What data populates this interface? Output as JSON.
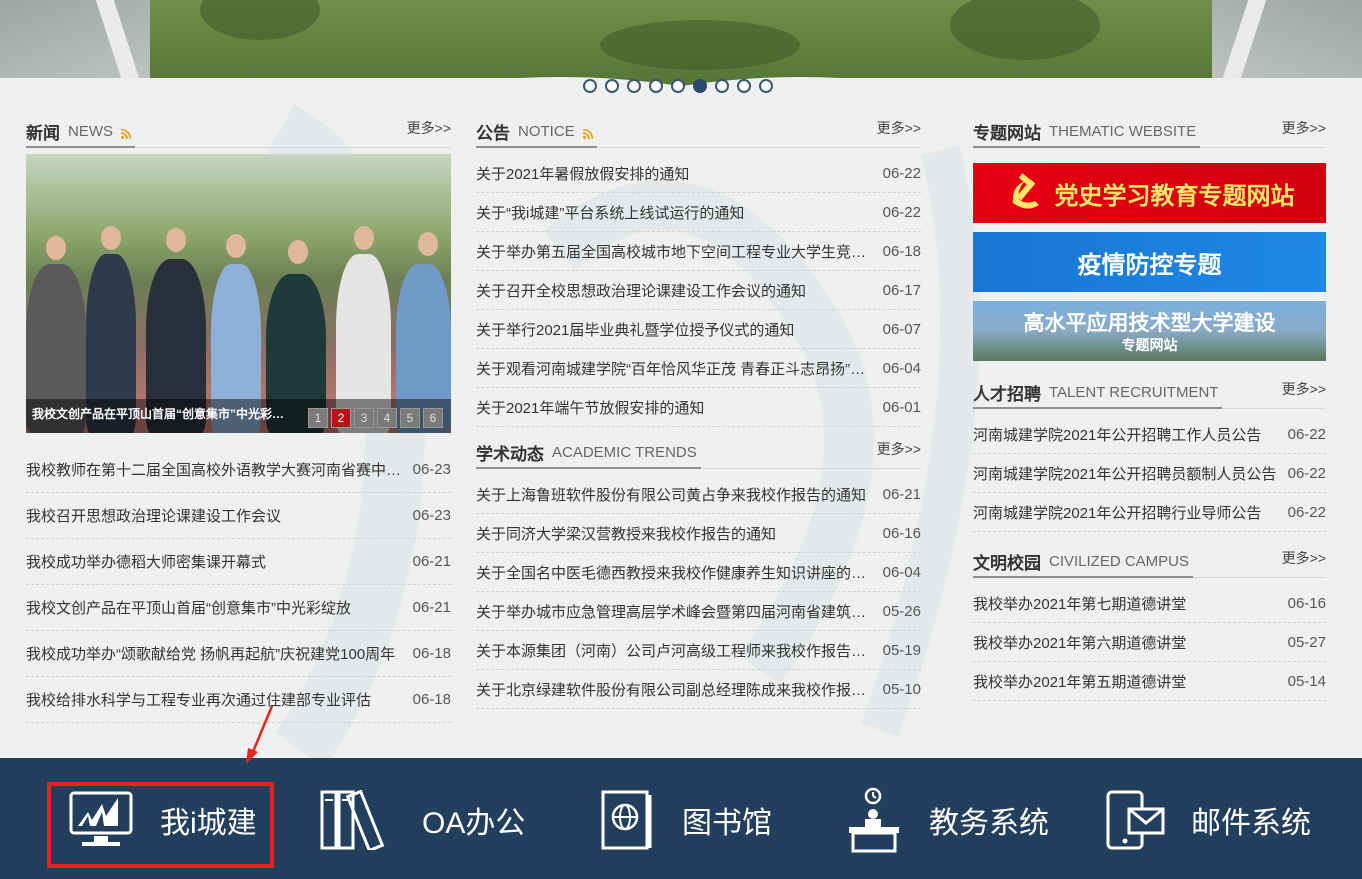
{
  "carousel": {
    "dots": 9,
    "active_index": 5
  },
  "news": {
    "title_cn": "新闻",
    "title_en": "NEWS",
    "more": "更多>>",
    "photo_caption": "我校文创产品在平顶山首届“创意集市”中光彩绽放",
    "pager": [
      "1",
      "2",
      "3",
      "4",
      "5",
      "6"
    ],
    "pager_active": 1,
    "items": [
      {
        "title": "我校教师在第十二届全国高校外语教学大赛河南省赛中获奖",
        "date": "06-23"
      },
      {
        "title": "我校召开思想政治理论课建设工作会议",
        "date": "06-23"
      },
      {
        "title": "我校成功举办德稻大师密集课开幕式",
        "date": "06-21"
      },
      {
        "title": "我校文创产品在平顶山首届“创意集市”中光彩绽放",
        "date": "06-21"
      },
      {
        "title": "我校成功举办“颂歌献给党 扬帆再起航”庆祝建党100周年",
        "date": "06-18"
      },
      {
        "title": "我校给排水科学与工程专业再次通过住建部专业评估",
        "date": "06-18"
      }
    ]
  },
  "notice": {
    "title_cn": "公告",
    "title_en": "NOTICE",
    "more": "更多>>",
    "items": [
      {
        "title": "关于2021年暑假放假安排的通知",
        "date": "06-22"
      },
      {
        "title": "关于“我i城建”平台系统上线试运行的通知",
        "date": "06-22"
      },
      {
        "title": "关于举办第五届全国高校城市地下空间工程专业大学生竞赛的通知",
        "date": "06-18"
      },
      {
        "title": "关于召开全校思想政治理论课建设工作会议的通知",
        "date": "06-17"
      },
      {
        "title": "关于举行2021届毕业典礼暨学位授予仪式的通知",
        "date": "06-07"
      },
      {
        "title": "关于观看河南城建学院“百年恰风华正茂 青春正斗志昂扬”的通知",
        "date": "06-04"
      },
      {
        "title": "关于2021年端午节放假安排的通知",
        "date": "06-01"
      }
    ]
  },
  "academic": {
    "title_cn": "学术动态",
    "title_en": "ACADEMIC TRENDS",
    "more": "更多>>",
    "items": [
      {
        "title": "关于上海鲁班软件股份有限公司黄占争来我校作报告的通知",
        "date": "06-21"
      },
      {
        "title": "关于同济大学梁汉营教授来我校作报告的通知",
        "date": "06-16"
      },
      {
        "title": "关于全国名中医毛德西教授来我校作健康养生知识讲座的通知",
        "date": "06-04"
      },
      {
        "title": "关于举办城市应急管理高层学术峰会暨第四届河南省建筑安全论坛的通知",
        "date": "05-26"
      },
      {
        "title": "关于本源集团（河南）公司卢河高级工程师来我校作报告的通知",
        "date": "05-19"
      },
      {
        "title": "关于北京绿建软件股份有限公司副总经理陈成来我校作报告的通知",
        "date": "05-10"
      }
    ]
  },
  "thematic": {
    "title_cn": "专题网站",
    "title_en": "THEMATIC WEBSITE",
    "more": "更多>>",
    "banners": [
      {
        "label": "党史学习教育专题网站"
      },
      {
        "label": "疫情防控专题"
      },
      {
        "label": "高水平应用技术型大学建设",
        "sub": "专题网站"
      }
    ]
  },
  "talent": {
    "title_cn": "人才招聘",
    "title_en": "TALENT RECRUITMENT",
    "more": "更多>>",
    "items": [
      {
        "title": "河南城建学院2021年公开招聘工作人员公告",
        "date": "06-22"
      },
      {
        "title": "河南城建学院2021年公开招聘员额制人员公告",
        "date": "06-22"
      },
      {
        "title": "河南城建学院2021年公开招聘行业导师公告",
        "date": "06-22"
      }
    ]
  },
  "campus": {
    "title_cn": "文明校园",
    "title_en": "CIVILIZED CAMPUS",
    "more": "更多>>",
    "items": [
      {
        "title": "我校举办2021年第七期道德讲堂",
        "date": "06-16"
      },
      {
        "title": "我校举办2021年第六期道德讲堂",
        "date": "05-27"
      },
      {
        "title": "我校举办2021年第五期道德讲堂",
        "date": "05-14"
      }
    ]
  },
  "systems": [
    {
      "label": "我i城建",
      "icon": "chart-monitor-icon"
    },
    {
      "label": "OA办公",
      "icon": "books-icon"
    },
    {
      "label": "图书馆",
      "icon": "globe-book-icon"
    },
    {
      "label": "教务系统",
      "icon": "lectern-icon"
    },
    {
      "label": "邮件系统",
      "icon": "phone-mail-icon"
    }
  ],
  "colors": {
    "footer_bg": "#233f5e",
    "highlight": "#e8231f",
    "pager_active": "#b3151a",
    "rss": "#f39800"
  }
}
